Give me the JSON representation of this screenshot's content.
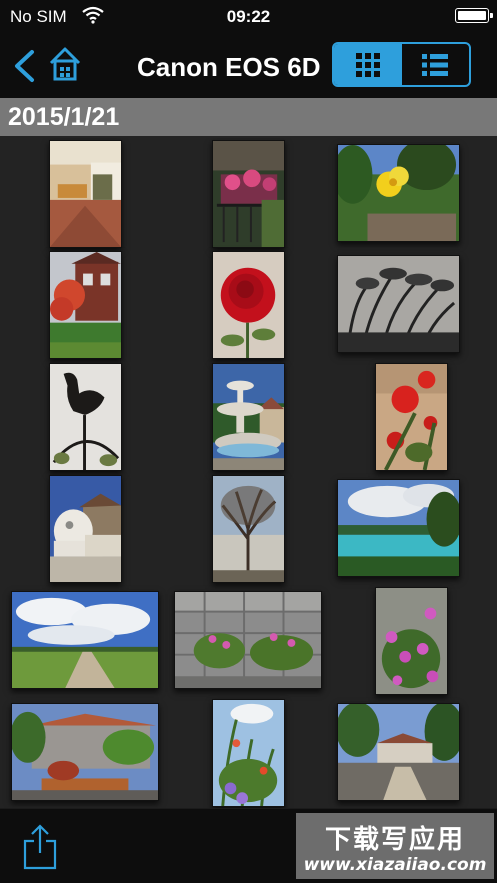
{
  "status_bar": {
    "carrier": "No SIM",
    "time": "09:22"
  },
  "nav": {
    "title": "Canon EOS 6D"
  },
  "date_section": {
    "label": "2015/1/21"
  },
  "photos": [
    "restaurant-terrace",
    "balcony-flowers",
    "yellow-hibiscus",
    "red-tree-house",
    "red-rose",
    "silver-grass",
    "rooster-weathervane",
    "garden-fountain",
    "red-flowers",
    "lion-statue",
    "bare-tree",
    "beach-bay",
    "country-road",
    "stone-wall-flowers",
    "pink-flowers",
    "tiled-roof-house",
    "wildflowers",
    "village-house"
  ],
  "watermark": {
    "main": "下载写应用",
    "url": "www.xiazaiiao.com"
  },
  "colors": {
    "accent": "#2e9fdc",
    "bar": "#0d0d0d",
    "header": "#787878",
    "background": "#232323"
  }
}
